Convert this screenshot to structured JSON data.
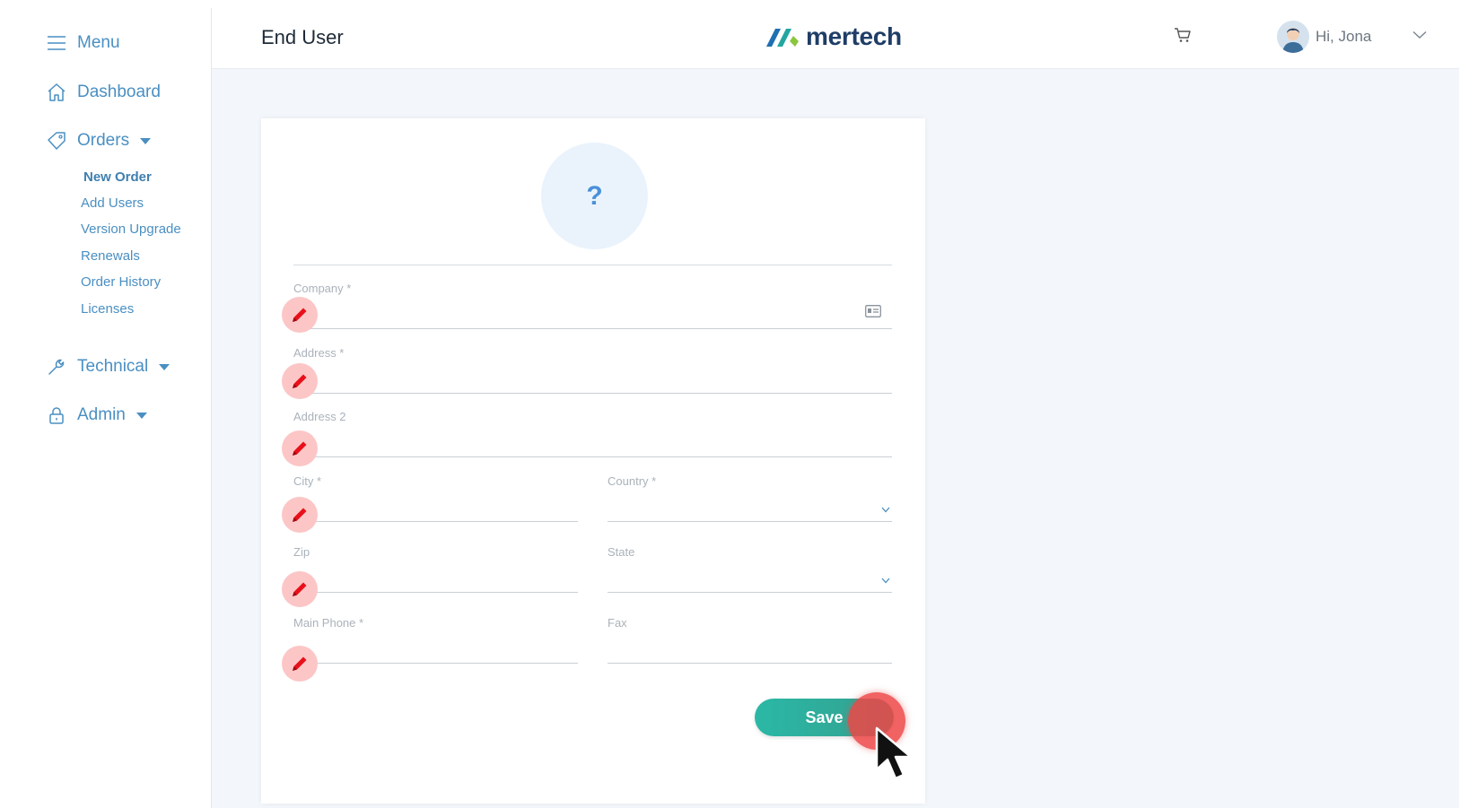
{
  "sidebar": {
    "menu_label": "Menu",
    "dashboard_label": "Dashboard",
    "orders_label": "Orders",
    "orders_items": [
      "New Order",
      "Add Users",
      "Version Upgrade",
      "Renewals",
      "Order History",
      "Licenses"
    ],
    "technical_label": "Technical",
    "admin_label": "Admin"
  },
  "header": {
    "page_title": "End User",
    "logo_text": "mertech",
    "greeting": "Hi, Jona"
  },
  "form": {
    "logo_placeholder": "?",
    "company_label": "Company *",
    "address_label": "Address *",
    "address2_label": "Address 2",
    "city_label": "City *",
    "country_label": "Country *",
    "zip_label": "Zip",
    "state_label": "State",
    "main_phone_label": "Main Phone *",
    "fax_label": "Fax",
    "save_label": "Save"
  },
  "colors": {
    "accent": "#4a8fc2",
    "save_gradient_start": "#2bb8a6",
    "save_gradient_end": "#34a08f",
    "pencil_bg": "#fcc6c6",
    "pencil_icon": "#e8101a",
    "click_indicator": "#ee4646"
  }
}
